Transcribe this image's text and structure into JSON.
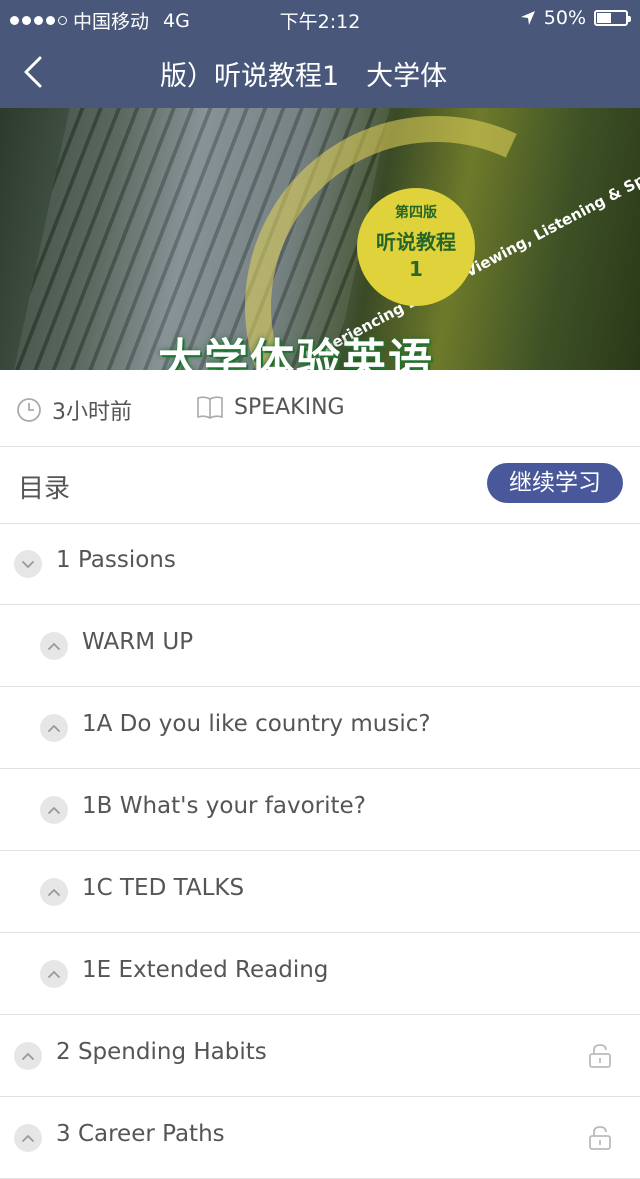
{
  "status_bar": {
    "carrier": "中国移动",
    "network": "4G",
    "time": "下午2:12",
    "battery": "50%",
    "battery_level": 0.5,
    "signal_bars": 4
  },
  "nav": {
    "title": "版）听说教程1　大学体"
  },
  "banner": {
    "arc_text": "Experiencing English Viewing, Listening & Speaking",
    "edition": "第四版",
    "course": "听说教程",
    "book_no": "1",
    "logo": "大学体验英语"
  },
  "meta": {
    "time_ago": "3小时前",
    "category": "SPEAKING"
  },
  "toc": {
    "label": "目录",
    "continue_button": "继续学习"
  },
  "units": [
    {
      "label": "1 Passions"
    },
    {
      "label": "WARM UP"
    },
    {
      "label": "1A Do you like country music?"
    },
    {
      "label": "1B What's your favorite?"
    },
    {
      "label": "1C TED TALKS"
    },
    {
      "label": "1E Extended Reading"
    },
    {
      "label": "2 Spending Habits"
    },
    {
      "label": "3 Career Paths"
    }
  ],
  "colors": {
    "header": "#48577a",
    "button": "#48589a"
  }
}
